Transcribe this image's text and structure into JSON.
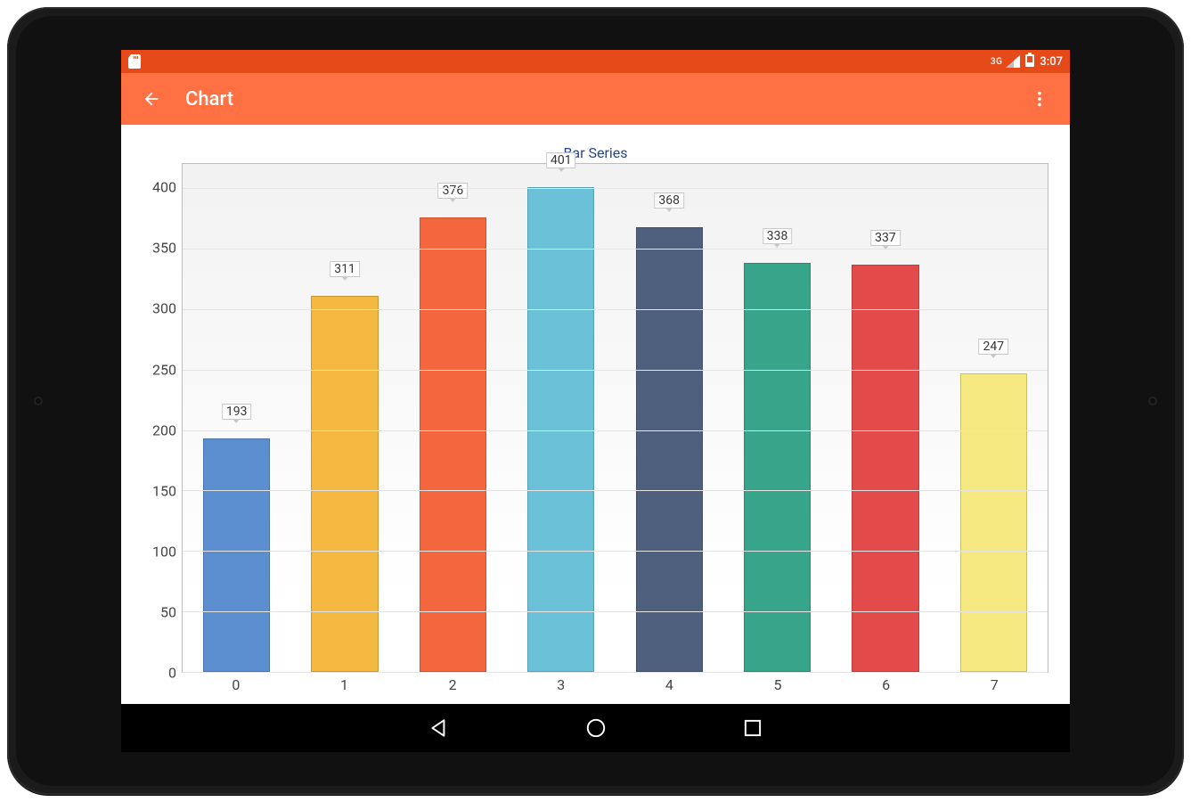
{
  "statusbar": {
    "network_label": "3G",
    "clock": "3:07"
  },
  "appbar": {
    "title": "Chart"
  },
  "chart_data": {
    "type": "bar",
    "title": "Bar Series",
    "categories": [
      "0",
      "1",
      "2",
      "3",
      "4",
      "5",
      "6",
      "7"
    ],
    "values": [
      193,
      311,
      376,
      401,
      368,
      338,
      337,
      247
    ],
    "colors": [
      "#5B8FD0",
      "#F5B942",
      "#F4673E",
      "#6BC2D8",
      "#4F607F",
      "#38A58B",
      "#E34B4B",
      "#F6E982"
    ],
    "y_ticks": [
      0,
      50,
      100,
      150,
      200,
      250,
      300,
      350,
      400
    ],
    "xlabel": "",
    "ylabel": "",
    "ylim": [
      0,
      420
    ]
  }
}
